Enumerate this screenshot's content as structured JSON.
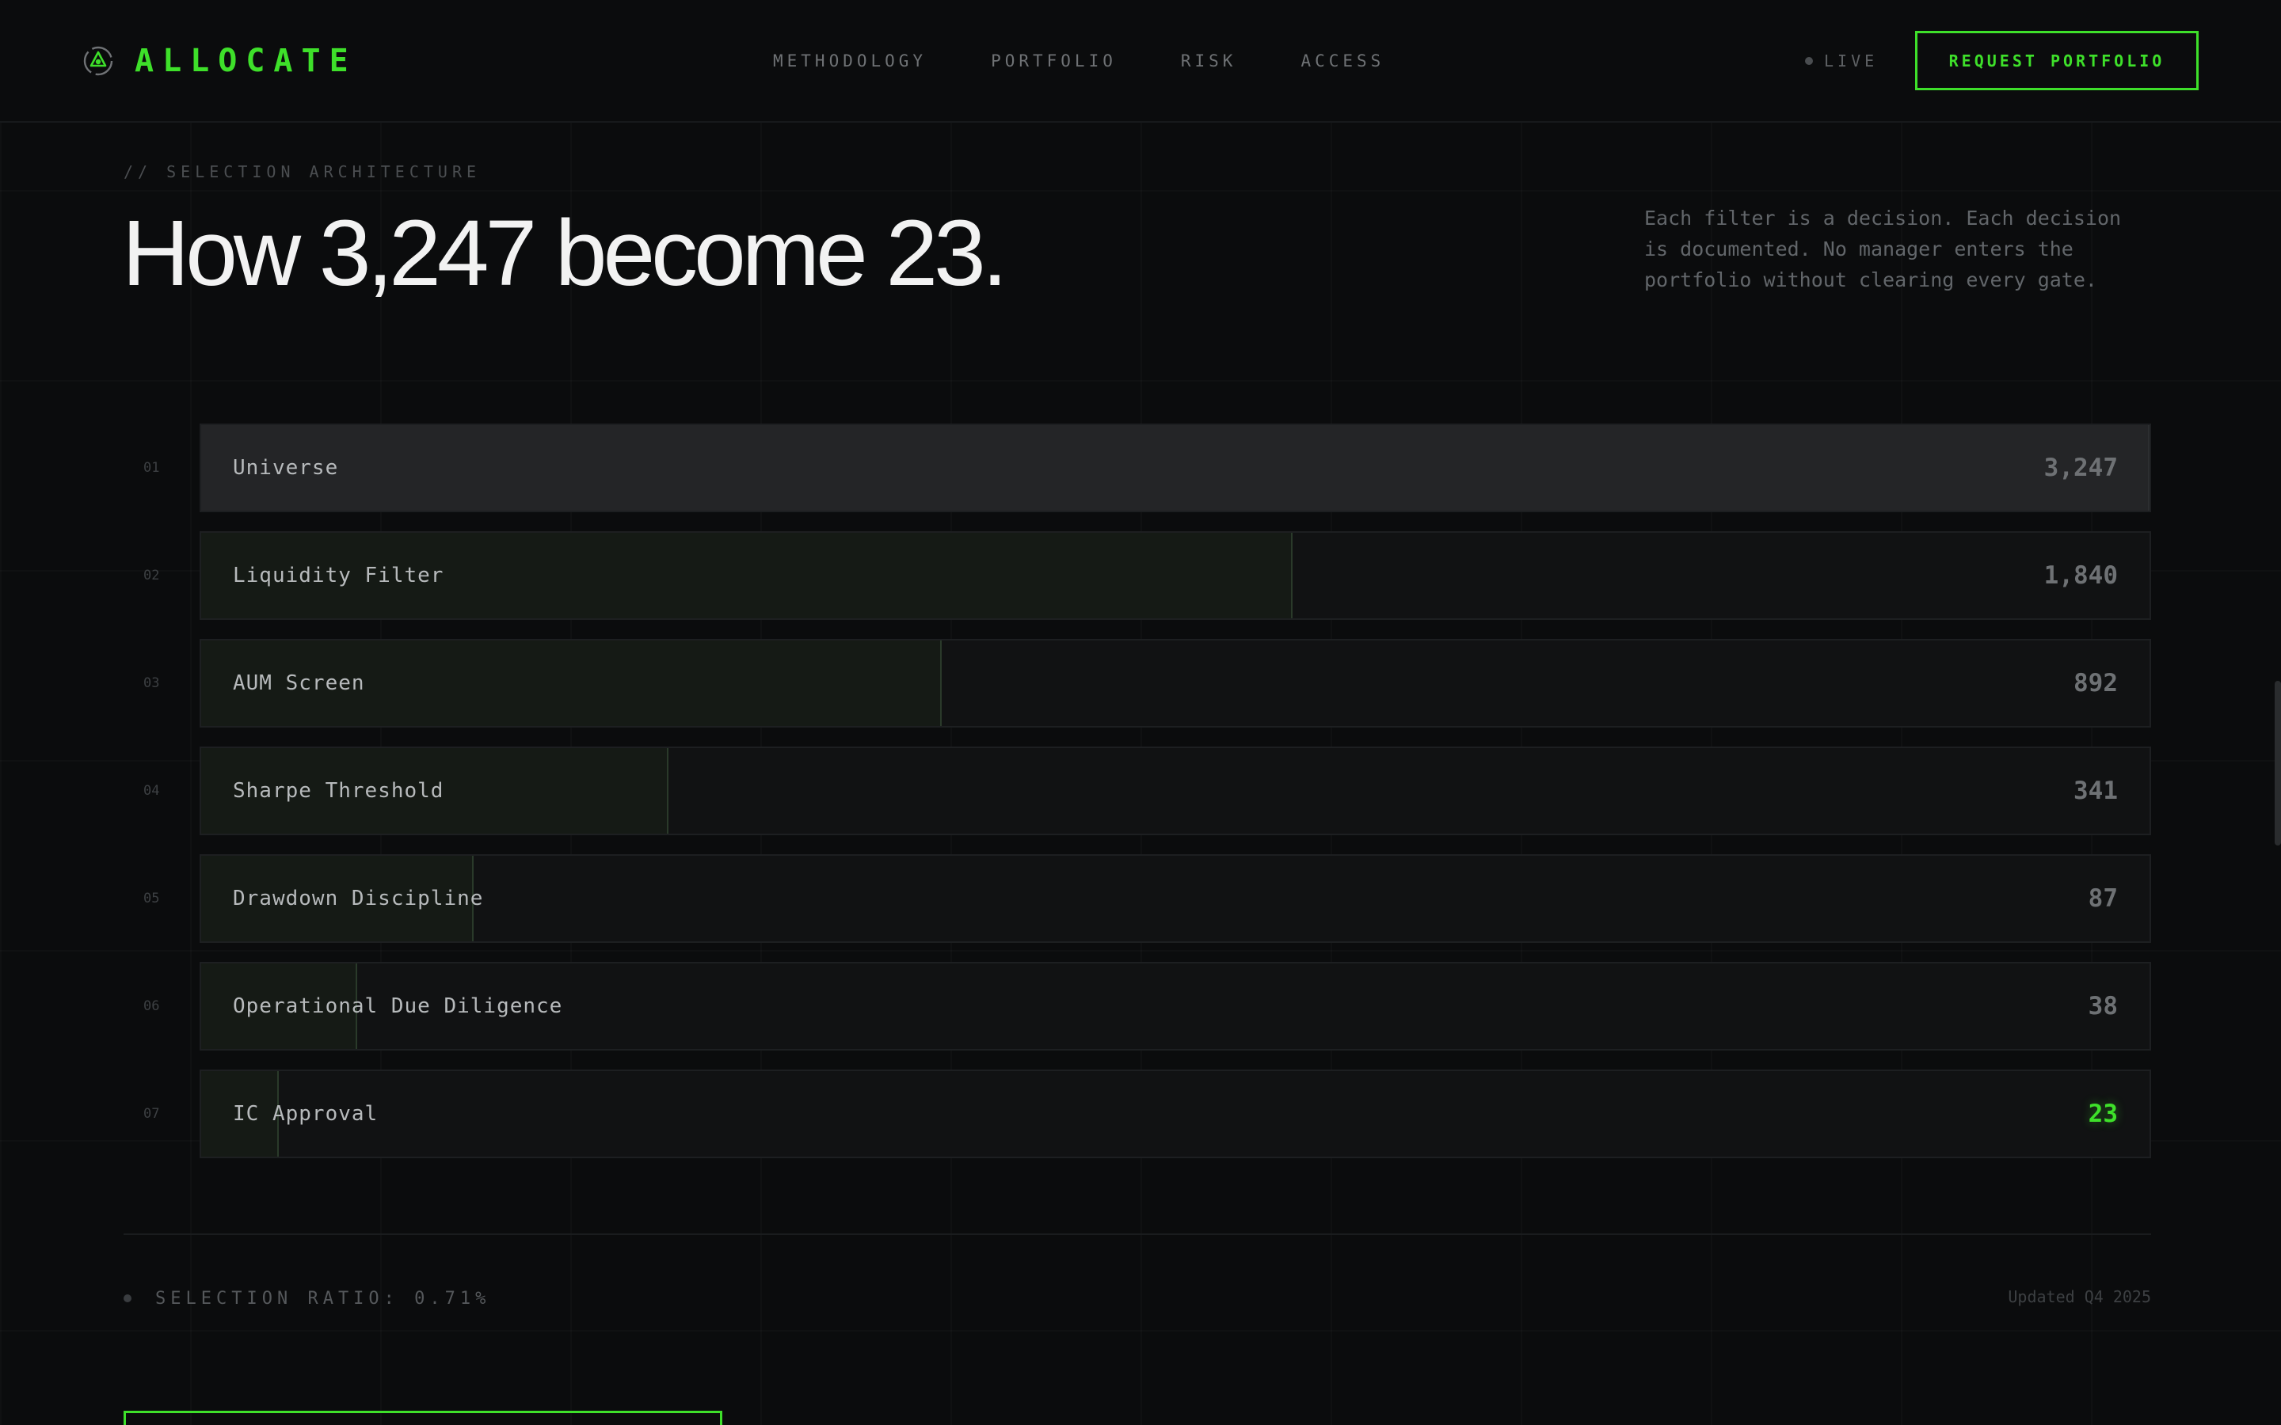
{
  "header": {
    "brand": "ALLOCATE",
    "brand_icon": "allocate-logo-icon",
    "nav": [
      "METHODOLOGY",
      "PORTFOLIO",
      "RISK",
      "ACCESS"
    ],
    "live_label": "LIVE",
    "cta_label": "REQUEST PORTFOLIO"
  },
  "section": {
    "eyebrow": "// SELECTION ARCHITECTURE",
    "headline": "How 3,247 become 23.",
    "intro": "Each filter is a decision. Each decision is documented. No manager enters the portfolio without clearing every gate."
  },
  "chart_data": {
    "type": "bar",
    "categories": [
      "Universe",
      "Liquidity Filter",
      "AUM Screen",
      "Sharpe Threshold",
      "Drawdown Discipline",
      "Operational Due Diligence",
      "IC Approval"
    ],
    "indices": [
      "01",
      "02",
      "03",
      "04",
      "05",
      "06",
      "07"
    ],
    "values": [
      3247,
      1840,
      892,
      341,
      87,
      38,
      23
    ],
    "value_labels": [
      "3,247",
      "1,840",
      "892",
      "341",
      "87",
      "38",
      "23"
    ],
    "fill_fractions": [
      1.0,
      0.56,
      0.38,
      0.24,
      0.14,
      0.08,
      0.04
    ],
    "colors": {
      "accent": "#3ee02a",
      "universe_fill": "#242527",
      "stage_fill": "#151a15"
    }
  },
  "footer": {
    "ratio": "SELECTION RATIO: 0.71%",
    "updated": "Updated Q4 2025"
  }
}
